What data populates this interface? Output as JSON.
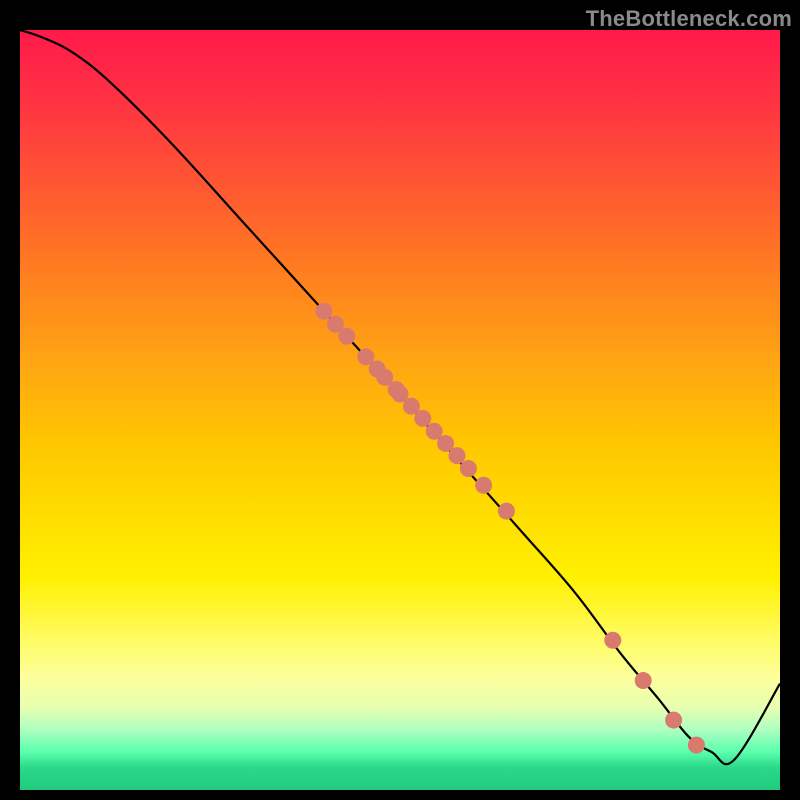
{
  "watermark": "TheBottleneck.com",
  "chart_data": {
    "type": "line",
    "title": "",
    "xlabel": "",
    "ylabel": "",
    "xlim": [
      0,
      100
    ],
    "ylim": [
      0,
      100
    ],
    "grid": false,
    "legend": false,
    "series": [
      {
        "name": "bottleneck-curve",
        "x": [
          0,
          3,
          7,
          12,
          20,
          30,
          40,
          50,
          58,
          66,
          73,
          79,
          84,
          88,
          91,
          94,
          100
        ],
        "y": [
          100,
          99,
          97,
          93,
          85,
          74,
          63,
          52,
          43,
          34,
          26,
          18,
          12,
          7,
          5,
          4,
          14
        ]
      }
    ],
    "highlight_points": {
      "name": "marker-dots",
      "color": "#d97a6f",
      "x": [
        40,
        41.5,
        43,
        45.5,
        47,
        48,
        49.5,
        50,
        51.5,
        53,
        54.5,
        56,
        57.5,
        59,
        61,
        64,
        78,
        82,
        86,
        89
      ],
      "y": [
        63,
        61.3,
        59.7,
        57,
        55.4,
        54.3,
        52.7,
        52.1,
        50.5,
        48.9,
        47.2,
        45.6,
        44,
        42.3,
        40.1,
        36.7,
        19.7,
        14.4,
        9.2,
        5.9
      ]
    }
  },
  "colors": {
    "curve_stroke": "#000000",
    "dot_fill": "#d97a6f"
  }
}
